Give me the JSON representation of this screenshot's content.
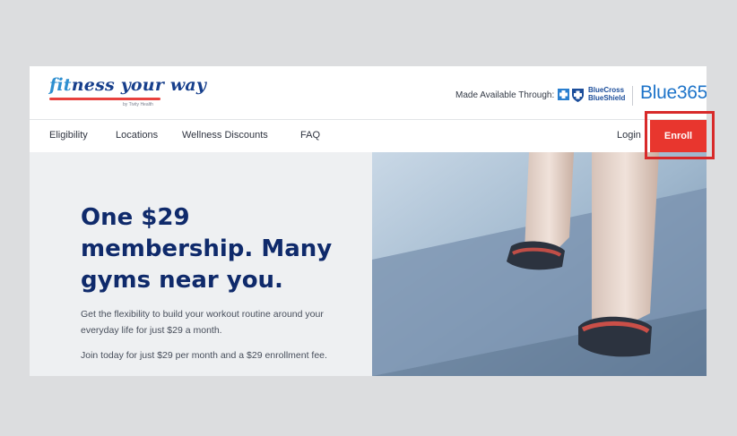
{
  "brand": {
    "logo_text_part1": "fit",
    "logo_text_part2": "ness your way",
    "logo_sub": "by Tivity Health"
  },
  "partner": {
    "available_text": "Made Available Through:",
    "bc_line1": "BlueCross",
    "bc_line2": "BlueShield",
    "blue365": "Blue365"
  },
  "nav": {
    "items": [
      "Eligibility",
      "Locations",
      "Wellness Discounts",
      "FAQ"
    ],
    "login": "Login",
    "enroll": "Enroll"
  },
  "hero": {
    "headline": "One $29 membership. Many gyms near you.",
    "sub1": "Get the flexibility to build your workout routine around your everyday life for just $29 a month.",
    "sub2": "Join today for just $29 per month and a $29 enrollment fee."
  },
  "colors": {
    "brand_blue": "#0f2a6b",
    "enroll_red": "#e8362e",
    "highlight_red": "#d82a2a",
    "blue365": "#1e74c9"
  }
}
